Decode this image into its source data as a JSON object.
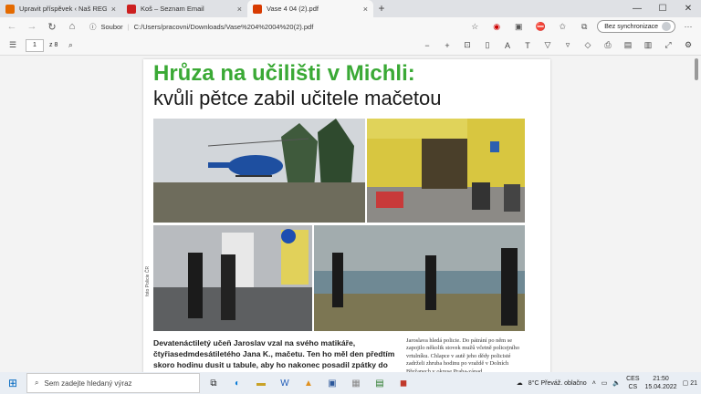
{
  "tabs": [
    {
      "title": "Upravit příspěvek ‹ Naš REGION",
      "close": "×",
      "color": "#e46a00"
    },
    {
      "title": "Koš – Seznam Email",
      "close": "×",
      "color": "#cc1f1f"
    },
    {
      "title": "Vase 4 04 (2).pdf",
      "close": "×",
      "color": "#d83b01"
    }
  ],
  "newtab": "+",
  "window": {
    "minimize": "—",
    "maximize": "☐",
    "close": "✕"
  },
  "address": {
    "back": "←",
    "forward": "→",
    "reload": "↻",
    "home": "⌂",
    "info": "ⓘ",
    "label": "Soubor",
    "url": "C:/Users/pracovni/Downloads/Vase%204%2004%20(2).pdf"
  },
  "sync": {
    "label": "Bez synchronizace"
  },
  "pdfbar": {
    "page": "1",
    "of": "z 8"
  },
  "article": {
    "title1": "Hrůza na učilišti v Michli:",
    "title2": "kvůli pětce zabil učitele mačetou",
    "photo_caption": "foto Policie ČR",
    "lead": "Devatenáctiletý učeň Jaroslav vzal na svého matikáře, čtyřiasedmdesátiletého Jana K., mačetu. Ten ho měl den předtím skoro hodinu dusit u tabule, aby ho nakonec posadil zpátky do lavice s pětkou. Zatímco ředitel podle svých slov nechápe, jak se",
    "body": "Jaroslava hledá policie. Do pátrání po něm se zapojilo několik stovek mužů včetně policejního vrtulníku. Chlapce v autě jeho dědy policisté zadrželi zhruba hodinu po vraždě v Dolních Břežanech v okrese Praha-západ."
  },
  "taskbar": {
    "search_placeholder": "Sem zadejte hledaný výraz",
    "weather": "8°C  Převáž. oblačno",
    "lang1": "CES",
    "lang2": "CS",
    "time": "21:50",
    "date": "15.04.2022",
    "notif": "21"
  }
}
